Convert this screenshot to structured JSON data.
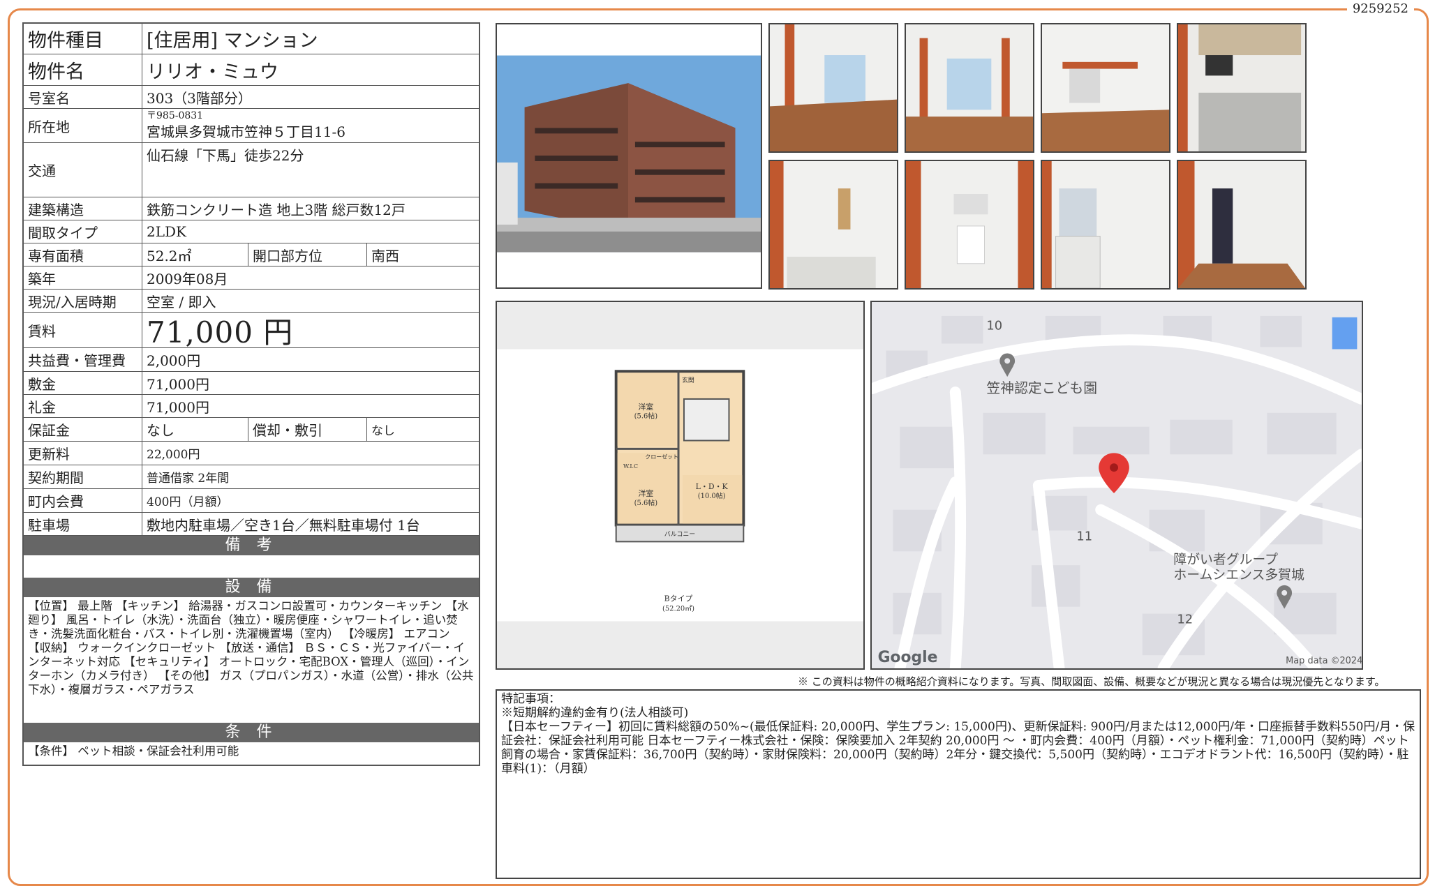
{
  "property_id": "9259252",
  "info_rows": {
    "type": {
      "label": "物件種目",
      "value": "[住居用]  マンション"
    },
    "name": {
      "label": "物件名",
      "value": "リリオ・ミュウ"
    },
    "room": {
      "label": "号室名",
      "value": "303（3階部分）"
    },
    "address": {
      "label": "所在地",
      "zip": "〒985-0831",
      "value": "宮城県多賀城市笠神５丁目11-6"
    },
    "transport": {
      "label": "交通",
      "value": "仙石線「下馬」徒歩22分"
    },
    "structure": {
      "label": "建築構造",
      "value": "鉄筋コンクリート造  地上3階  総戸数12戸"
    },
    "layout": {
      "label": "間取タイプ",
      "value": "2LDK"
    },
    "area": {
      "label": "専有面積",
      "value": "52.2㎡",
      "label2": "開口部方位",
      "value2": "南西"
    },
    "built": {
      "label": "築年",
      "value": "2009年08月"
    },
    "status": {
      "label": "現況/入居時期",
      "value": "空室 /  即入"
    },
    "rent": {
      "label": "賃料",
      "value": "71,000 円"
    },
    "fee": {
      "label": "共益費・管理費",
      "value": "2,000円"
    },
    "deposit": {
      "label": "敷金",
      "value": "71,000円"
    },
    "key_money": {
      "label": "礼金",
      "value": "71,000円"
    },
    "guarantee": {
      "label": "保証金",
      "value": "なし",
      "label2": "償却・敷引",
      "value2": "なし"
    },
    "renewal": {
      "label": "更新料",
      "value": "22,000円"
    },
    "contract": {
      "label": "契約期間",
      "value": "普通借家  2年間"
    },
    "association": {
      "label": "町内会費",
      "value": "400円（月額）"
    },
    "parking": {
      "label": "駐車場",
      "value": "敷地内駐車場／空き1台／無料駐車場付  1台"
    }
  },
  "sections": {
    "notes_title": "備 考",
    "notes_body": "",
    "equipment_title": "設 備",
    "equipment_body": "【位置】 最上階 【キッチン】 給湯器・ガスコンロ設置可・カウンターキッチン 【水廻り】 風呂・トイレ（水洗）・洗面台（独立）・暖房便座・シャワートイレ・追い焚き・洗髪洗面化粧台・バス・トイレ別・洗濯機置場（室内） 【冷暖房】 エアコン 【収納】 ウォークインクローゼット 【放送・通信】 ＢＳ・ＣＳ・光ファイバー・インターネット対応 【セキュリティ】 オートロック・宅配BOX・管理人（巡回）・インターホン（カメラ付き） 【その他】 ガス（プロパンガス）・水道（公営）・排水（公共下水）・複層ガラス・ペアガラス",
    "conditions_title": "条 件",
    "conditions_body": "【条件】 ペット相談・保証会社利用可能"
  },
  "floorplan": {
    "rooms": [
      "洋室",
      "(5.6帖)",
      "洋室",
      "(5.6帖)",
      "L・D・K",
      "(10.0帖)",
      "玄関",
      "W.I.C",
      "クローゼット",
      "バルコニー"
    ],
    "caption": "Bタイプ",
    "caption_area": "(52.20㎡)"
  },
  "map": {
    "labels": [
      "10",
      "笠神認定こども園",
      "11",
      "障がい者グループ",
      "ホームシエンス多賀城",
      "12"
    ],
    "brand": "Google",
    "credit": "Map data ©2024",
    "marker_color": "#e53935"
  },
  "disclaimer": "※ この資料は物件の概略紹介資料になります。写真、間取図面、設備、概要などが現況と異なる場合は現況優先となります。",
  "remarks": {
    "title": "特記事項：",
    "lines": [
      "※短期解約違約金有り(法人相談可)",
      "【日本セーフティー】初回に賃料総額の50%~(最低保証料: 20,000円、学生プラン: 15,000円)、更新保証料: 900円/月または12,000円/年・口座振替手数料550円/月・保証会社：保証会社利用可能 日本セーフティー株式会社・保険：保険要加入 2年契約 20,000円 ～ ・町内会費：400円（月額）・ペット権利金：71,000円（契約時）ペット飼育の場合・家賃保証料：36,700円（契約時）・家財保険料：20,000円（契約時）2年分・鍵交換代：5,500円（契約時）・エコデオドラント代：16,500円（契約時）・駐車料(1)：（月額）"
    ]
  },
  "colors": {
    "frame": "#e6884a",
    "section_header": "#666666"
  }
}
